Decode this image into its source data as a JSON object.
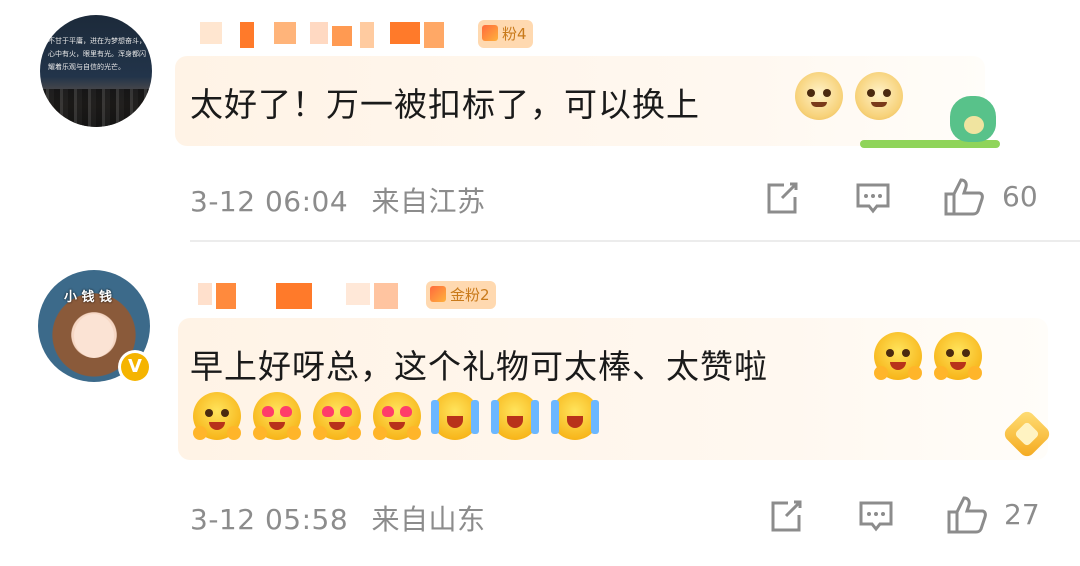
{
  "comments": [
    {
      "badge": "粉4",
      "text": "太好了！万一被扣标了，可以换上",
      "time": "3-12 06:04",
      "location": "来自江苏",
      "likes": "60",
      "avatar_text": "不甘于平庸，进在为梦想奋斗，心中有火，眼里有光。浑身都闪耀着乐观与自信的光芒。",
      "icons": [
        "doge-emoji",
        "doge-emoji",
        "dinosaur-sticker"
      ]
    },
    {
      "badge": "金粉2",
      "text": "早上好呀总，这个礼物可太棒、太赞啦",
      "time": "3-12 05:58",
      "location": "来自山东",
      "likes": "27",
      "avatar_text": "小 钱 钱",
      "icons": [
        "heart-emoji",
        "heart-emoji",
        "heart-eyes-emoji",
        "heart-eyes-emoji",
        "heart-eyes-emoji",
        "laugh-cry-emoji",
        "laugh-cry-emoji",
        "laugh-cry-emoji"
      ]
    }
  ],
  "colors": {
    "accent": "#f5b400",
    "badge_bg": "#ffd9b0",
    "meta_text": "#8c8c8c",
    "bubble": "#fff3e6",
    "pixelated_name": "#ff8a3d"
  }
}
